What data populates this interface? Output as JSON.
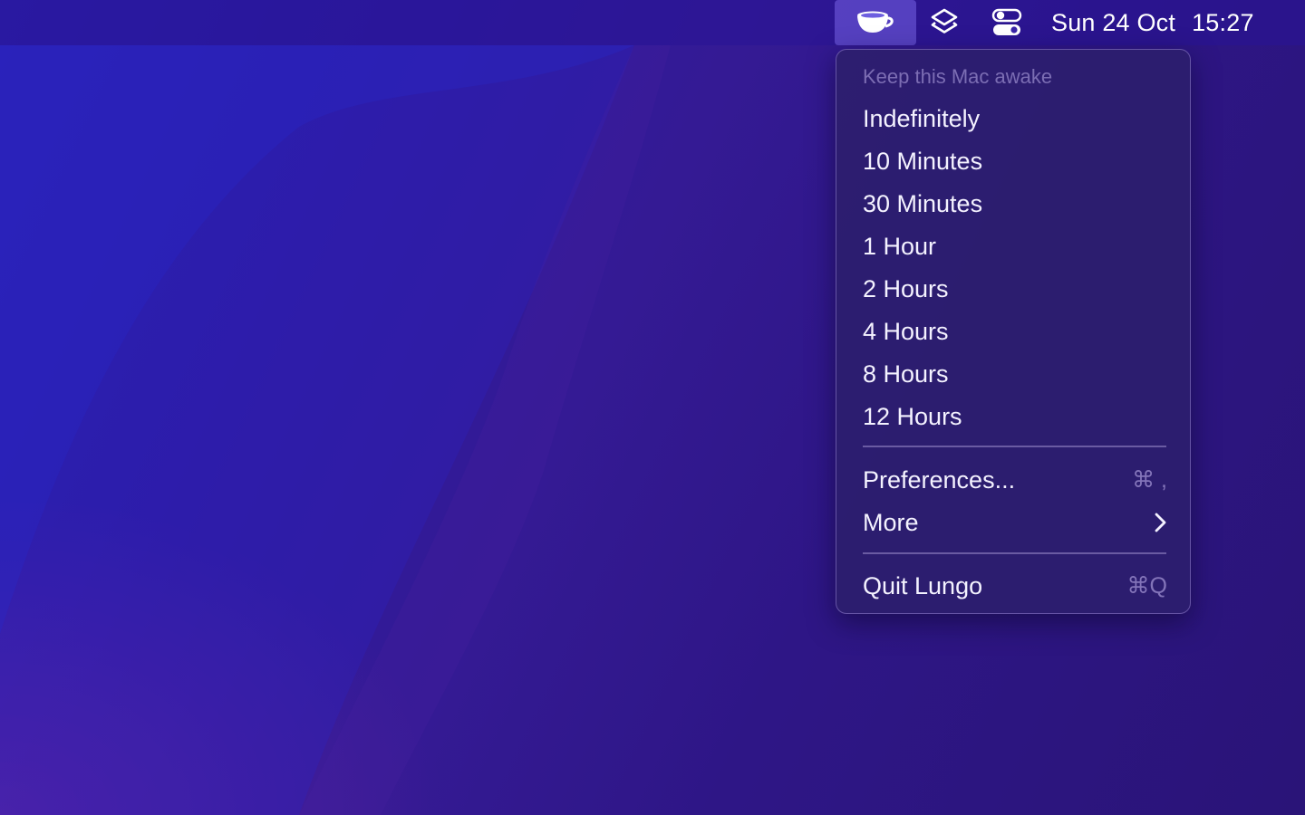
{
  "menubar": {
    "icons": [
      "coffee-cup-icon",
      "layers-icon",
      "control-center-icon"
    ],
    "date": "Sun 24 Oct",
    "time": "15:27"
  },
  "menu": {
    "header": "Keep this Mac awake",
    "durations": [
      "Indefinitely",
      "10 Minutes",
      "30 Minutes",
      "1 Hour",
      "2 Hours",
      "4 Hours",
      "8 Hours",
      "12 Hours"
    ],
    "preferences": {
      "label": "Preferences...",
      "shortcut": "⌘ ,"
    },
    "more": {
      "label": "More",
      "icon": "chevron-right-icon"
    },
    "quit": {
      "label": "Quit Lungo",
      "shortcut": "⌘Q"
    }
  },
  "colors": {
    "menubar_highlight": "#6e5fe0",
    "menu_background": "#2c1e6e",
    "text": "#f4f2ff",
    "dim_text": "#b9aee8"
  }
}
